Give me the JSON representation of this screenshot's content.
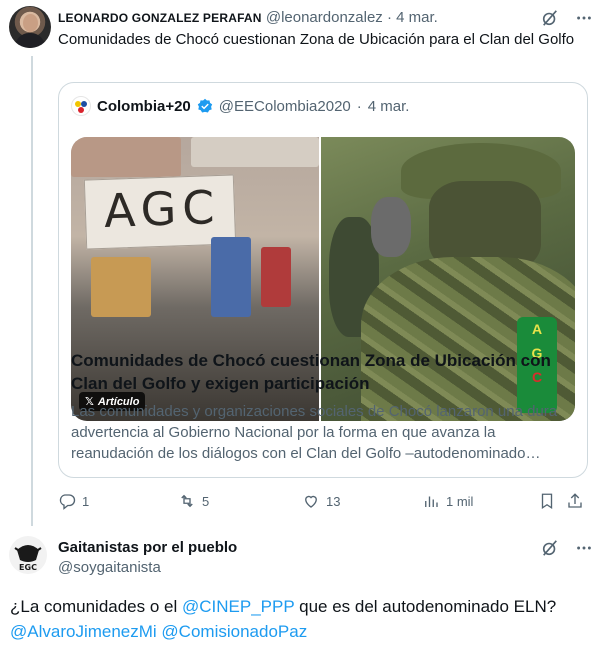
{
  "tweet1": {
    "author_name": "LEONARDO GONZALEZ PERAFAN",
    "author_handle": "@leonardonzalez",
    "separator": "·",
    "date": "4 mar.",
    "text": "Comunidades de Chocó cuestionan Zona de Ubicación para el Clan del Golfo",
    "quote": {
      "author_name": "Colombia+20",
      "author_handle": "@EEColombia2020",
      "separator": "·",
      "date": "4 mar.",
      "media_sign_text": "AGC",
      "media_armband_text": [
        "A",
        "G",
        "C"
      ],
      "media_badge": "Artículo",
      "title": "Comunidades de Chocó cuestionan Zona de Ubicación con Clan del Golfo y exigen participación",
      "description": "Las comunidades y organizaciones sociales de Chocó lanzaron una dura advertencia al Gobierno Nacional por la forma en que avanza la reanudación de los diálogos con el Clan del Golfo –autodenominado…"
    },
    "actions": {
      "replies": "1",
      "retweets": "5",
      "likes": "13",
      "views": "1 mil"
    }
  },
  "tweet2": {
    "author_name": "Gaitanistas por el pueblo",
    "author_handle": "@soygaitanista",
    "avatar_text": "EGC",
    "text_prefix": "¿La comunidades o el ",
    "mention1": "@CINEP_PPP",
    "text_middle": " que es del autodenominado ELN?",
    "mention2": "@AlvaroJimenezMi",
    "mention3": "@ComisionadoPaz"
  },
  "icons": {
    "grok": "grok-slash-icon",
    "more": "more-dots-icon",
    "verified": "verified-badge-icon",
    "reply": "reply-icon",
    "retweet": "retweet-icon",
    "like": "like-icon",
    "views": "views-icon",
    "bookmark": "bookmark-icon",
    "share": "share-icon"
  },
  "colors": {
    "link": "#1d9bf0",
    "muted": "#536471",
    "border": "#cfd9de",
    "verified": "#1d9bf0"
  }
}
